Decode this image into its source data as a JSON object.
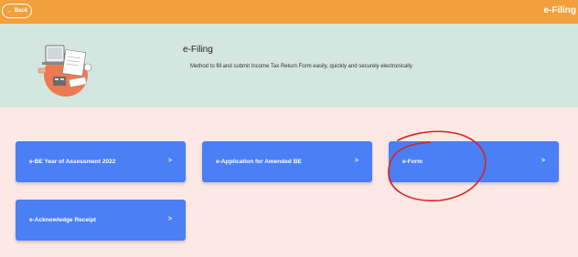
{
  "header": {
    "back_label": "Back",
    "back_icon": "arrow-left-icon",
    "title": "e-Filing",
    "color": "#f2a03b"
  },
  "hero": {
    "title": "e-Filing",
    "description": "Method to fill and submit Income Tax Return Form easily, quickly and securely electronically",
    "background": "#d4e6e0"
  },
  "cards": [
    {
      "label": "e-BE Year of Assessment 2022",
      "chevron": ">"
    },
    {
      "label": "e-Application for Amended BE",
      "chevron": ">"
    },
    {
      "label": "e-Form",
      "chevron": ">"
    },
    {
      "label": "e-Acknowledge Receipt",
      "chevron": ">"
    }
  ],
  "card_color": "#4a7ff5",
  "annotation_color": "#e02020"
}
